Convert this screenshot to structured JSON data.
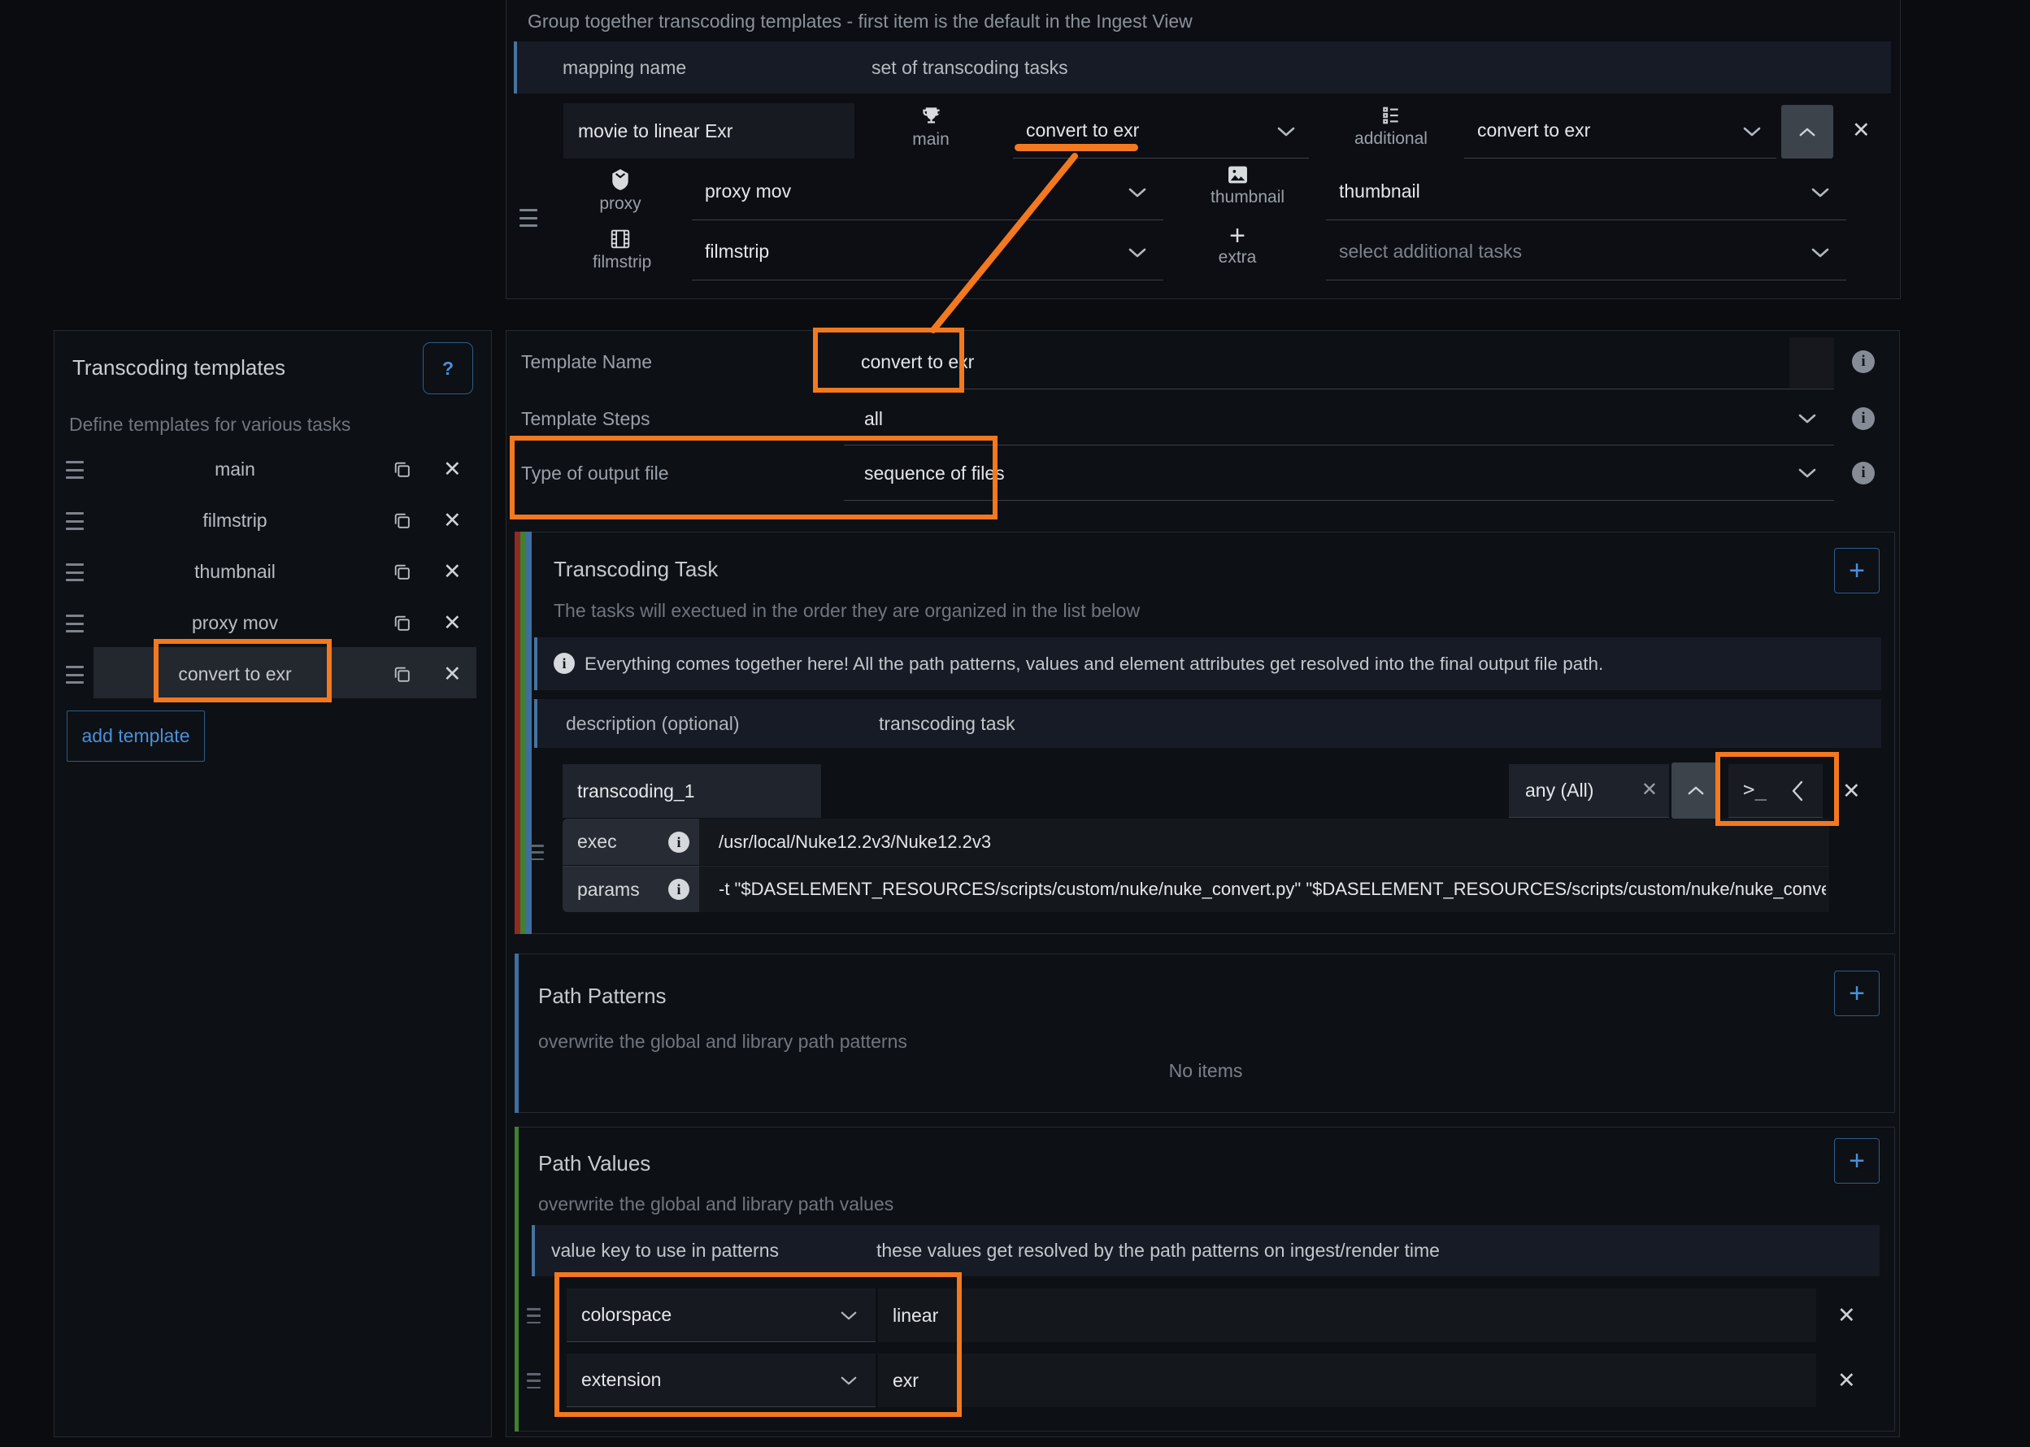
{
  "icons": {
    "close": "✕",
    "help": "?",
    "plus": "+",
    "terminal": ">_",
    "info_letter": "i"
  },
  "mapping_box": {
    "hint": "Group together transcoding templates - first item is the default in the Ingest View",
    "col_mapping_name": "mapping name",
    "col_tasks": "set of transcoding tasks",
    "name_value": "movie to linear Exr",
    "main_label": "main",
    "main_value": "convert to exr",
    "additional_label": "additional",
    "additional_value": "convert to exr",
    "proxy_label": "proxy",
    "proxy_value": "proxy mov",
    "thumbnail_label": "thumbnail",
    "thumbnail_value": "thumbnail",
    "filmstrip_label": "filmstrip",
    "filmstrip_value": "filmstrip",
    "extra_label": "extra",
    "extra_placeholder": "select additional tasks"
  },
  "sidebar": {
    "title": "Transcoding templates",
    "subtitle": "Define templates for various tasks",
    "items": [
      {
        "label": "main"
      },
      {
        "label": "filmstrip"
      },
      {
        "label": "thumbnail"
      },
      {
        "label": "proxy mov"
      },
      {
        "label": "convert to exr"
      }
    ],
    "add_button": "add template"
  },
  "editor": {
    "template_name_label": "Template Name",
    "template_name_value": "convert to exr",
    "template_steps_label": "Template Steps",
    "template_steps_value": "all",
    "output_type_label": "Type of output file",
    "output_type_value": "sequence of files",
    "task_section": {
      "title": "Transcoding Task",
      "subtitle": "The tasks will exectued in the order they are organized in the list below",
      "info": "Everything comes together here! All the path patterns, values and element attributes get resolved into the final output file path.",
      "desc_label": "description (optional)",
      "desc_value": "transcoding task",
      "task_name": "transcoding_1",
      "filter_value": "any (All)",
      "exec_label": "exec",
      "exec_value": "/usr/local/Nuke12.2v3/Nuke12.2v3",
      "params_label": "params",
      "params_value": "-t \"$DASELEMENT_RESOURCES/scripts/custom/nuke/nuke_convert.py\" \"$DASELEMENT_RESOURCES/scripts/custom/nuke/nuke_convert_lin"
    },
    "path_patterns": {
      "title": "Path Patterns",
      "subtitle": "overwrite the global and library path patterns",
      "empty": "No items"
    },
    "path_values": {
      "title": "Path Values",
      "subtitle": "overwrite the global and library path values",
      "col_key": "value key to use in patterns",
      "col_desc": "these values get resolved by the path patterns on ingest/render time",
      "rows": [
        {
          "key": "colorspace",
          "value": "linear"
        },
        {
          "key": "extension",
          "value": "exr"
        }
      ]
    }
  },
  "colors": {
    "annotation": "#f2791f",
    "accent_blue": "#4a90d9",
    "stripe_red": "#8f2b24",
    "stripe_green": "#41802e",
    "stripe_blue": "#3e6fa0"
  }
}
